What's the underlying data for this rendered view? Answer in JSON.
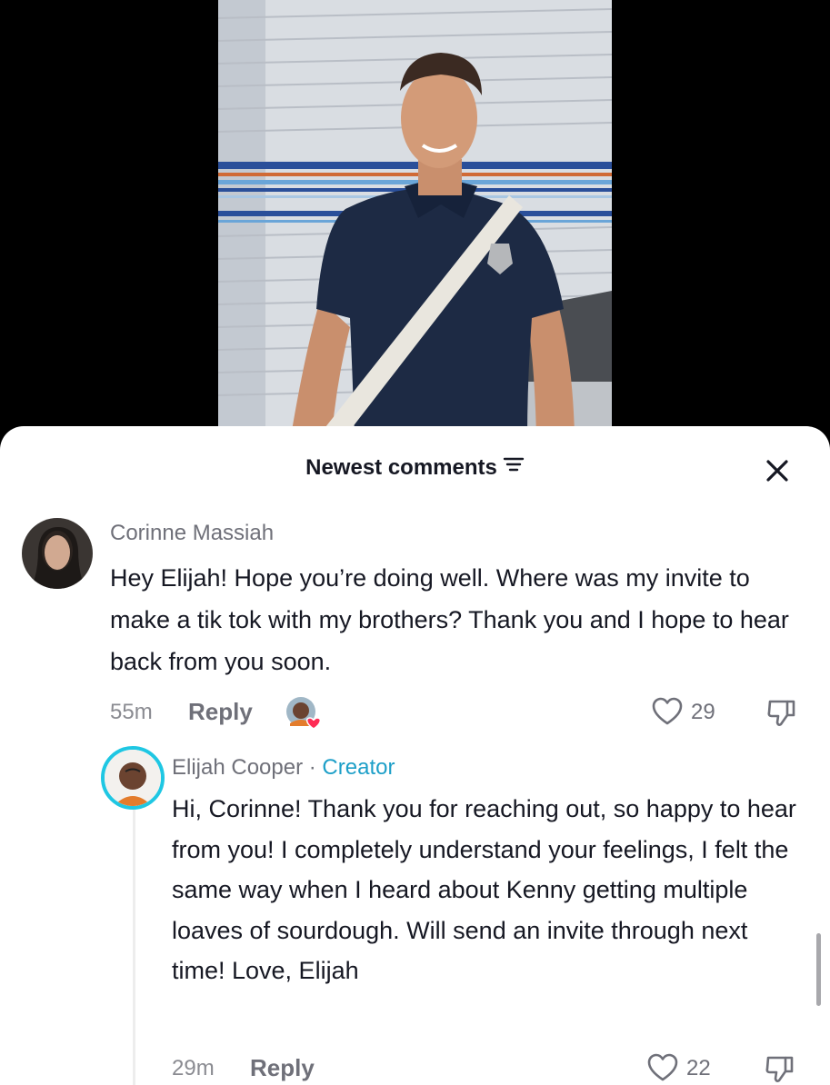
{
  "sheet": {
    "title": "Newest comments",
    "filter_icon": "filter-icon",
    "close_icon": "close-icon"
  },
  "comments": [
    {
      "username": "Corinne Massiah",
      "text": "Hey Elijah! Hope you’re doing well. Where was my invite to make a tik tok with my brothers? Thank you and I hope to hear back from you soon.",
      "time": "55m",
      "reply_label": "Reply",
      "likes": "29",
      "creator_liked": true
    },
    {
      "username": "Elijah Cooper",
      "separator": " · ",
      "badge": "Creator",
      "text": "Hi, Corinne! Thank you for reaching out, so happy to hear from you! I completely understand your feelings, I felt the same way when I heard about Kenny getting multiple loaves of sourdough. Will send an invite through next time! Love, Elijah",
      "time": "29m",
      "reply_label": "Reply",
      "likes": "22"
    }
  ],
  "colors": {
    "creator_accent": "#1d9fc8",
    "liked_heart": "#fe2c55",
    "text_primary": "#161823",
    "text_secondary": "#6f7079"
  }
}
